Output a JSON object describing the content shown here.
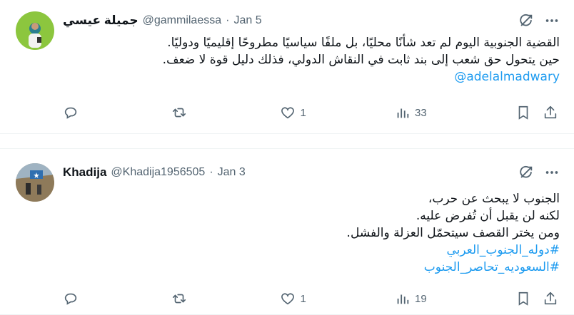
{
  "tweets": [
    {
      "author_name": "جميلة عيسي",
      "handle": "@gammilaessa",
      "separator": "·",
      "date": "Jan 5",
      "lines": [
        "القضية الجنوبية اليوم لم تعد شأنًا محليًا، بل ملفًا سياسيًا مطروحًا إقليميًا ودوليًا.",
        "حين يتحول حق شعب إلى بند ثابت في النقاش الدولي، فذلك دليل قوة لا ضعف."
      ],
      "mention": "@adelalmadwary",
      "hashtags": [],
      "replies": "",
      "retweets": "",
      "likes": "1",
      "views": "33"
    },
    {
      "author_name": "Khadija",
      "handle": "@Khadija1956505",
      "separator": "·",
      "date": "Jan 3",
      "lines": [
        "الجنوب لا يبحث عن حرب،",
        "لكنه لن يقبل أن تُفرض عليه.",
        "ومن يختر القصف سيتحمّل العزلة والفشل."
      ],
      "mention": "",
      "hashtags": [
        "#دوله_الجنوب_العربي",
        "#السعوديه_تحاصر_الجنوب"
      ],
      "replies": "",
      "retweets": "",
      "likes": "1",
      "views": "19"
    }
  ],
  "colors": {
    "link": "#1d9bf0",
    "muted": "#536471",
    "text": "#0f1419",
    "divider": "#eff3f4"
  },
  "icons": [
    "grok-icon",
    "more-icon",
    "reply-icon",
    "retweet-icon",
    "like-icon",
    "views-icon",
    "bookmark-icon",
    "share-icon"
  ]
}
